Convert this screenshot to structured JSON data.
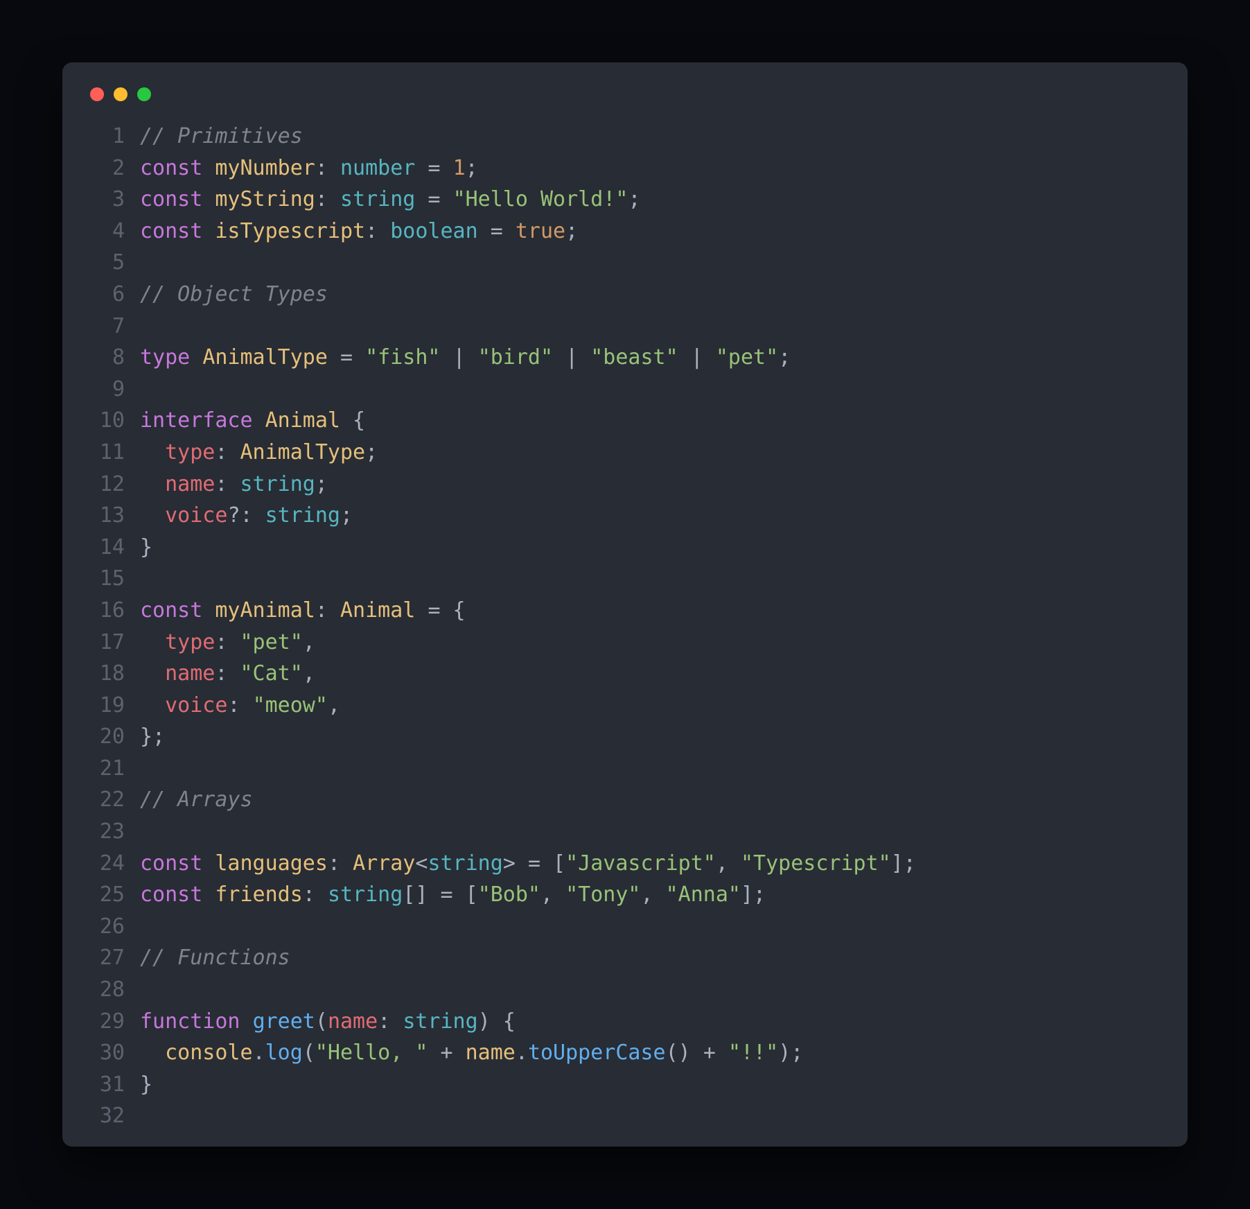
{
  "window": {
    "dots": [
      "red",
      "yellow",
      "green"
    ]
  },
  "theme": {
    "bg_outer": "#08090e",
    "bg_card": "#282c34",
    "comment": "#7f848e",
    "keyword": "#c678dd",
    "variable": "#e5c07b",
    "type": "#56b6c2",
    "string": "#98c379",
    "prop": "#e06c75",
    "operator": "#abb2bf",
    "plain": "#abb2bf",
    "number": "#d19a66",
    "funcname": "#61afef"
  },
  "code": {
    "lines": [
      {
        "n": "1",
        "t": [
          [
            "comment",
            "// Primitives"
          ]
        ]
      },
      {
        "n": "2",
        "t": [
          [
            "keyword",
            "const"
          ],
          [
            "plain",
            " "
          ],
          [
            "variable",
            "myNumber"
          ],
          [
            "operator",
            ":"
          ],
          [
            "plain",
            " "
          ],
          [
            "type",
            "number"
          ],
          [
            "plain",
            " "
          ],
          [
            "operator",
            "="
          ],
          [
            "plain",
            " "
          ],
          [
            "number",
            "1"
          ],
          [
            "plain",
            ";"
          ]
        ]
      },
      {
        "n": "3",
        "t": [
          [
            "keyword",
            "const"
          ],
          [
            "plain",
            " "
          ],
          [
            "variable",
            "myString"
          ],
          [
            "operator",
            ":"
          ],
          [
            "plain",
            " "
          ],
          [
            "type",
            "string"
          ],
          [
            "plain",
            " "
          ],
          [
            "operator",
            "="
          ],
          [
            "plain",
            " "
          ],
          [
            "string",
            "\"Hello World!\""
          ],
          [
            "plain",
            ";"
          ]
        ]
      },
      {
        "n": "4",
        "t": [
          [
            "keyword",
            "const"
          ],
          [
            "plain",
            " "
          ],
          [
            "variable",
            "isTypescript"
          ],
          [
            "operator",
            ":"
          ],
          [
            "plain",
            " "
          ],
          [
            "type",
            "boolean"
          ],
          [
            "plain",
            " "
          ],
          [
            "operator",
            "="
          ],
          [
            "plain",
            " "
          ],
          [
            "bool",
            "true"
          ],
          [
            "plain",
            ";"
          ]
        ]
      },
      {
        "n": "5",
        "t": []
      },
      {
        "n": "6",
        "t": [
          [
            "comment",
            "// Object Types"
          ]
        ]
      },
      {
        "n": "7",
        "t": []
      },
      {
        "n": "8",
        "t": [
          [
            "keyword",
            "type"
          ],
          [
            "plain",
            " "
          ],
          [
            "variable",
            "AnimalType"
          ],
          [
            "plain",
            " "
          ],
          [
            "operator",
            "="
          ],
          [
            "plain",
            " "
          ],
          [
            "string",
            "\"fish\""
          ],
          [
            "plain",
            " "
          ],
          [
            "operator",
            "|"
          ],
          [
            "plain",
            " "
          ],
          [
            "string",
            "\"bird\""
          ],
          [
            "plain",
            " "
          ],
          [
            "operator",
            "|"
          ],
          [
            "plain",
            " "
          ],
          [
            "string",
            "\"beast\""
          ],
          [
            "plain",
            " "
          ],
          [
            "operator",
            "|"
          ],
          [
            "plain",
            " "
          ],
          [
            "string",
            "\"pet\""
          ],
          [
            "plain",
            ";"
          ]
        ]
      },
      {
        "n": "9",
        "t": []
      },
      {
        "n": "10",
        "t": [
          [
            "keyword",
            "interface"
          ],
          [
            "plain",
            " "
          ],
          [
            "variable",
            "Animal"
          ],
          [
            "plain",
            " {"
          ]
        ]
      },
      {
        "n": "11",
        "t": [
          [
            "plain",
            "  "
          ],
          [
            "prop",
            "type"
          ],
          [
            "operator",
            ":"
          ],
          [
            "plain",
            " "
          ],
          [
            "variable",
            "AnimalType"
          ],
          [
            "plain",
            ";"
          ]
        ]
      },
      {
        "n": "12",
        "t": [
          [
            "plain",
            "  "
          ],
          [
            "prop",
            "name"
          ],
          [
            "operator",
            ":"
          ],
          [
            "plain",
            " "
          ],
          [
            "type",
            "string"
          ],
          [
            "plain",
            ";"
          ]
        ]
      },
      {
        "n": "13",
        "t": [
          [
            "plain",
            "  "
          ],
          [
            "prop",
            "voice"
          ],
          [
            "operator",
            "?:"
          ],
          [
            "plain",
            " "
          ],
          [
            "type",
            "string"
          ],
          [
            "plain",
            ";"
          ]
        ]
      },
      {
        "n": "14",
        "t": [
          [
            "plain",
            "}"
          ]
        ]
      },
      {
        "n": "15",
        "t": []
      },
      {
        "n": "16",
        "t": [
          [
            "keyword",
            "const"
          ],
          [
            "plain",
            " "
          ],
          [
            "variable",
            "myAnimal"
          ],
          [
            "operator",
            ":"
          ],
          [
            "plain",
            " "
          ],
          [
            "variable",
            "Animal"
          ],
          [
            "plain",
            " "
          ],
          [
            "operator",
            "="
          ],
          [
            "plain",
            " {"
          ]
        ]
      },
      {
        "n": "17",
        "t": [
          [
            "plain",
            "  "
          ],
          [
            "prop",
            "type"
          ],
          [
            "operator",
            ":"
          ],
          [
            "plain",
            " "
          ],
          [
            "string",
            "\"pet\""
          ],
          [
            "plain",
            ","
          ]
        ]
      },
      {
        "n": "18",
        "t": [
          [
            "plain",
            "  "
          ],
          [
            "prop",
            "name"
          ],
          [
            "operator",
            ":"
          ],
          [
            "plain",
            " "
          ],
          [
            "string",
            "\"Cat\""
          ],
          [
            "plain",
            ","
          ]
        ]
      },
      {
        "n": "19",
        "t": [
          [
            "plain",
            "  "
          ],
          [
            "prop",
            "voice"
          ],
          [
            "operator",
            ":"
          ],
          [
            "plain",
            " "
          ],
          [
            "string",
            "\"meow\""
          ],
          [
            "plain",
            ","
          ]
        ]
      },
      {
        "n": "20",
        "t": [
          [
            "plain",
            "};"
          ]
        ]
      },
      {
        "n": "21",
        "t": []
      },
      {
        "n": "22",
        "t": [
          [
            "comment",
            "// Arrays"
          ]
        ]
      },
      {
        "n": "23",
        "t": []
      },
      {
        "n": "24",
        "t": [
          [
            "keyword",
            "const"
          ],
          [
            "plain",
            " "
          ],
          [
            "variable",
            "languages"
          ],
          [
            "operator",
            ":"
          ],
          [
            "plain",
            " "
          ],
          [
            "variable",
            "Array"
          ],
          [
            "operator",
            "<"
          ],
          [
            "type",
            "string"
          ],
          [
            "operator",
            ">"
          ],
          [
            "plain",
            " "
          ],
          [
            "operator",
            "="
          ],
          [
            "plain",
            " ["
          ],
          [
            "string",
            "\"Javascript\""
          ],
          [
            "plain",
            ", "
          ],
          [
            "string",
            "\"Typescript\""
          ],
          [
            "plain",
            "];"
          ]
        ]
      },
      {
        "n": "25",
        "t": [
          [
            "keyword",
            "const"
          ],
          [
            "plain",
            " "
          ],
          [
            "variable",
            "friends"
          ],
          [
            "operator",
            ":"
          ],
          [
            "plain",
            " "
          ],
          [
            "type",
            "string"
          ],
          [
            "plain",
            "[]"
          ],
          [
            "plain",
            " "
          ],
          [
            "operator",
            "="
          ],
          [
            "plain",
            " ["
          ],
          [
            "string",
            "\"Bob\""
          ],
          [
            "plain",
            ", "
          ],
          [
            "string",
            "\"Tony\""
          ],
          [
            "plain",
            ", "
          ],
          [
            "string",
            "\"Anna\""
          ],
          [
            "plain",
            "];"
          ]
        ]
      },
      {
        "n": "26",
        "t": []
      },
      {
        "n": "27",
        "t": [
          [
            "comment",
            "// Functions"
          ]
        ]
      },
      {
        "n": "28",
        "t": []
      },
      {
        "n": "29",
        "t": [
          [
            "keyword",
            "function"
          ],
          [
            "plain",
            " "
          ],
          [
            "funcname",
            "greet"
          ],
          [
            "plain",
            "("
          ],
          [
            "prop",
            "name"
          ],
          [
            "operator",
            ":"
          ],
          [
            "plain",
            " "
          ],
          [
            "type",
            "string"
          ],
          [
            "plain",
            ") {"
          ]
        ]
      },
      {
        "n": "30",
        "t": [
          [
            "plain",
            "  "
          ],
          [
            "variable",
            "console"
          ],
          [
            "plain",
            "."
          ],
          [
            "funcname",
            "log"
          ],
          [
            "plain",
            "("
          ],
          [
            "string",
            "\"Hello, \""
          ],
          [
            "plain",
            " "
          ],
          [
            "operator",
            "+"
          ],
          [
            "plain",
            " "
          ],
          [
            "variable",
            "name"
          ],
          [
            "plain",
            "."
          ],
          [
            "funcname",
            "toUpperCase"
          ],
          [
            "plain",
            "()"
          ],
          [
            "plain",
            " "
          ],
          [
            "operator",
            "+"
          ],
          [
            "plain",
            " "
          ],
          [
            "string",
            "\"!!\""
          ],
          [
            "plain",
            ");"
          ]
        ]
      },
      {
        "n": "31",
        "t": [
          [
            "plain",
            "}"
          ]
        ]
      },
      {
        "n": "32",
        "t": []
      }
    ]
  }
}
